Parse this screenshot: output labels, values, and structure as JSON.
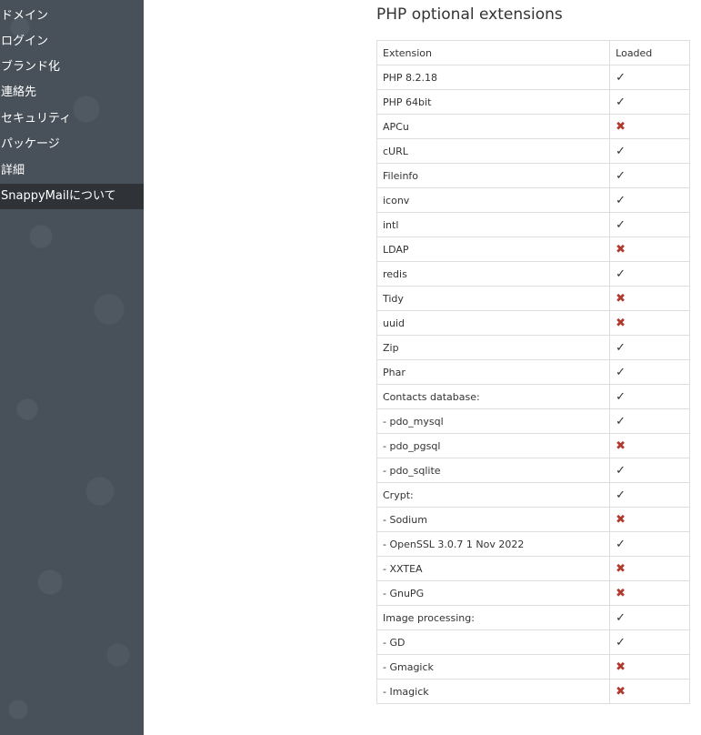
{
  "sidebar": {
    "items": [
      {
        "label": "ドメイン",
        "selected": false
      },
      {
        "label": "ログイン",
        "selected": false
      },
      {
        "label": "ブランド化",
        "selected": false
      },
      {
        "label": "連絡先",
        "selected": false
      },
      {
        "label": "セキュリティ",
        "selected": false
      },
      {
        "label": "パッケージ",
        "selected": false
      },
      {
        "label": "詳細",
        "selected": false
      },
      {
        "label": "SnappyMailについて",
        "selected": true
      }
    ]
  },
  "main": {
    "title": "PHP optional extensions",
    "table": {
      "headers": [
        "Extension",
        "Loaded"
      ],
      "rows": [
        {
          "name": "PHP 8.2.18",
          "loaded": true
        },
        {
          "name": "PHP 64bit",
          "loaded": true
        },
        {
          "name": "APCu",
          "loaded": false
        },
        {
          "name": "cURL",
          "loaded": true
        },
        {
          "name": "Fileinfo",
          "loaded": true
        },
        {
          "name": "iconv",
          "loaded": true
        },
        {
          "name": "intl",
          "loaded": true
        },
        {
          "name": "LDAP",
          "loaded": false
        },
        {
          "name": "redis",
          "loaded": true
        },
        {
          "name": "Tidy",
          "loaded": false
        },
        {
          "name": "uuid",
          "loaded": false
        },
        {
          "name": "Zip",
          "loaded": true
        },
        {
          "name": "Phar",
          "loaded": true
        },
        {
          "name": "Contacts database:",
          "loaded": true
        },
        {
          "name": "- pdo_mysql",
          "loaded": true
        },
        {
          "name": "- pdo_pgsql",
          "loaded": false
        },
        {
          "name": "- pdo_sqlite",
          "loaded": true
        },
        {
          "name": "Crypt:",
          "loaded": true
        },
        {
          "name": "- Sodium",
          "loaded": false
        },
        {
          "name": "- OpenSSL 3.0.7 1 Nov 2022",
          "loaded": true
        },
        {
          "name": "- XXTEA",
          "loaded": false
        },
        {
          "name": "- GnuPG",
          "loaded": false
        },
        {
          "name": "Image processing:",
          "loaded": true
        },
        {
          "name": "- GD",
          "loaded": true
        },
        {
          "name": "- Gmagick",
          "loaded": false
        },
        {
          "name": "- Imagick",
          "loaded": false
        }
      ]
    },
    "marks": {
      "yes": "✓",
      "no": "✖"
    },
    "colors": {
      "no_mark": "#b03a2e",
      "sidebar_bg": "#48515a",
      "sidebar_selected": "#2f3338"
    }
  }
}
